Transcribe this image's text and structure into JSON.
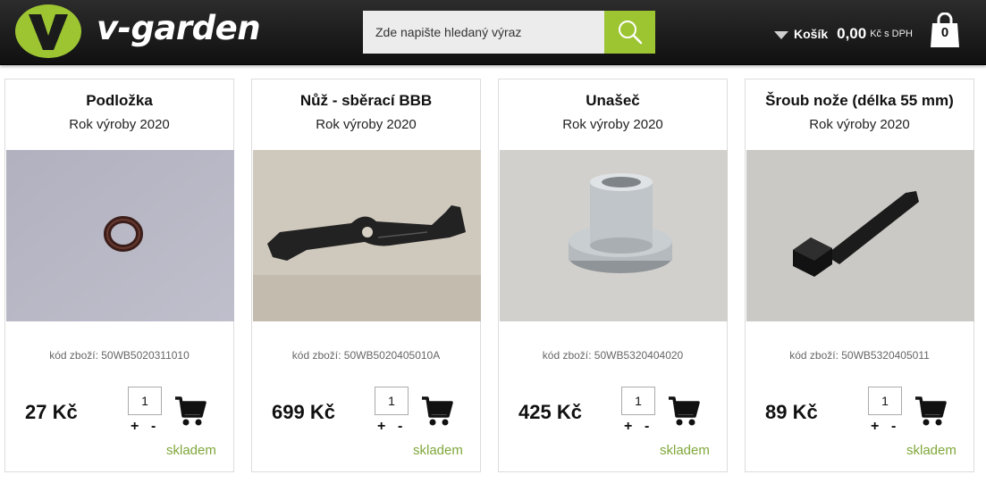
{
  "header": {
    "brand": "v-garden",
    "search_placeholder": "Zde napište hledaný výraz",
    "cart_label": "Košík",
    "cart_amount": "0,00",
    "cart_currency": "Kč s DPH",
    "cart_count": "0",
    "accent_color": "#9dc532"
  },
  "products": [
    {
      "title": "Podložka",
      "subtitle": "Rok výroby 2020",
      "code": "kód zboží: 50WB5020311010",
      "price": "27 Kč",
      "qty": "1",
      "plus": "+",
      "minus": "-",
      "stock": "skladem"
    },
    {
      "title": "Nůž - sběrací BBB",
      "subtitle": "Rok výroby 2020",
      "code": "kód zboží: 50WB5020405010A",
      "price": "699 Kč",
      "qty": "1",
      "plus": "+",
      "minus": "-",
      "stock": "skladem"
    },
    {
      "title": "Unašeč",
      "subtitle": "Rok výroby 2020",
      "code": "kód zboží: 50WB5320404020",
      "price": "425 Kč",
      "qty": "1",
      "plus": "+",
      "minus": "-",
      "stock": "skladem"
    },
    {
      "title": "Šroub nože (délka 55 mm)",
      "subtitle": "Rok výroby 2020",
      "code": "kód zboží: 50WB5320405011",
      "price": "89 Kč",
      "qty": "1",
      "plus": "+",
      "minus": "-",
      "stock": "skladem"
    }
  ],
  "icons": {
    "logo": "v-garden-logo-icon",
    "search": "search-icon",
    "cart_caret": "caret-down-icon",
    "cart_bag": "shopping-bag-icon",
    "add_to_cart": "shopping-cart-icon"
  }
}
